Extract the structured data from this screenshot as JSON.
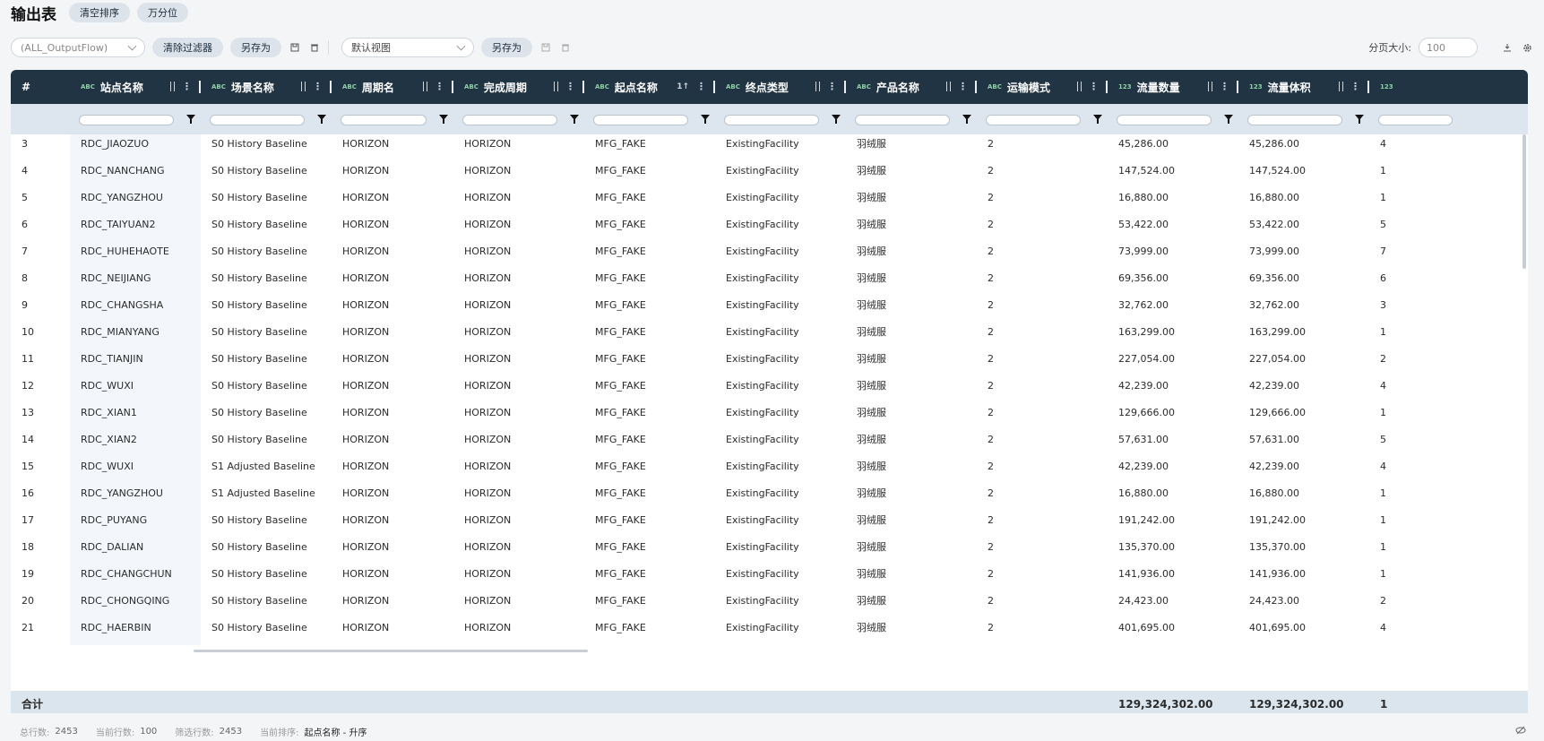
{
  "title": "输出表",
  "top_buttons": [
    "清空排序",
    "万分位"
  ],
  "toolbar": {
    "filter_select": "(ALL_OutputFlow)",
    "clear_filter": "清除过滤器",
    "save_as_1": "另存为",
    "view_select": "默认视图",
    "save_as_2": "另存为",
    "page_size_label": "分页大小:",
    "page_size_value": "100"
  },
  "columns": [
    {
      "label": "#",
      "type": ""
    },
    {
      "label": "站点名称",
      "type": "ABC"
    },
    {
      "label": "场景名称",
      "type": "ABC"
    },
    {
      "label": "周期名",
      "type": "ABC"
    },
    {
      "label": "完成周期",
      "type": "ABC"
    },
    {
      "label": "起点名称",
      "type": "ABC",
      "sort": "1↑"
    },
    {
      "label": "终点类型",
      "type": "ABC"
    },
    {
      "label": "产品名称",
      "type": "ABC"
    },
    {
      "label": "运输模式",
      "type": "ABC"
    },
    {
      "label": "流量数量",
      "type": "123"
    },
    {
      "label": "流量体积",
      "type": "123"
    },
    {
      "label": "",
      "type": "123"
    }
  ],
  "rows": [
    [
      "3",
      "RDC_JIAOZUO",
      "S0 History Baseline",
      "HORIZON",
      "HORIZON",
      "MFG_FAKE",
      "ExistingFacility",
      "羽绒服",
      "2",
      "45,286.00",
      "45,286.00",
      "4"
    ],
    [
      "4",
      "RDC_NANCHANG",
      "S0 History Baseline",
      "HORIZON",
      "HORIZON",
      "MFG_FAKE",
      "ExistingFacility",
      "羽绒服",
      "2",
      "147,524.00",
      "147,524.00",
      "1"
    ],
    [
      "5",
      "RDC_YANGZHOU",
      "S0 History Baseline",
      "HORIZON",
      "HORIZON",
      "MFG_FAKE",
      "ExistingFacility",
      "羽绒服",
      "2",
      "16,880.00",
      "16,880.00",
      "1"
    ],
    [
      "6",
      "RDC_TAIYUAN2",
      "S0 History Baseline",
      "HORIZON",
      "HORIZON",
      "MFG_FAKE",
      "ExistingFacility",
      "羽绒服",
      "2",
      "53,422.00",
      "53,422.00",
      "5"
    ],
    [
      "7",
      "RDC_HUHEHAOTE",
      "S0 History Baseline",
      "HORIZON",
      "HORIZON",
      "MFG_FAKE",
      "ExistingFacility",
      "羽绒服",
      "2",
      "73,999.00",
      "73,999.00",
      "7"
    ],
    [
      "8",
      "RDC_NEIJIANG",
      "S0 History Baseline",
      "HORIZON",
      "HORIZON",
      "MFG_FAKE",
      "ExistingFacility",
      "羽绒服",
      "2",
      "69,356.00",
      "69,356.00",
      "6"
    ],
    [
      "9",
      "RDC_CHANGSHA",
      "S0 History Baseline",
      "HORIZON",
      "HORIZON",
      "MFG_FAKE",
      "ExistingFacility",
      "羽绒服",
      "2",
      "32,762.00",
      "32,762.00",
      "3"
    ],
    [
      "10",
      "RDC_MIANYANG",
      "S0 History Baseline",
      "HORIZON",
      "HORIZON",
      "MFG_FAKE",
      "ExistingFacility",
      "羽绒服",
      "2",
      "163,299.00",
      "163,299.00",
      "1"
    ],
    [
      "11",
      "RDC_TIANJIN",
      "S0 History Baseline",
      "HORIZON",
      "HORIZON",
      "MFG_FAKE",
      "ExistingFacility",
      "羽绒服",
      "2",
      "227,054.00",
      "227,054.00",
      "2"
    ],
    [
      "12",
      "RDC_WUXI",
      "S0 History Baseline",
      "HORIZON",
      "HORIZON",
      "MFG_FAKE",
      "ExistingFacility",
      "羽绒服",
      "2",
      "42,239.00",
      "42,239.00",
      "4"
    ],
    [
      "13",
      "RDC_XIAN1",
      "S0 History Baseline",
      "HORIZON",
      "HORIZON",
      "MFG_FAKE",
      "ExistingFacility",
      "羽绒服",
      "2",
      "129,666.00",
      "129,666.00",
      "1"
    ],
    [
      "14",
      "RDC_XIAN2",
      "S0 History Baseline",
      "HORIZON",
      "HORIZON",
      "MFG_FAKE",
      "ExistingFacility",
      "羽绒服",
      "2",
      "57,631.00",
      "57,631.00",
      "5"
    ],
    [
      "15",
      "RDC_WUXI",
      "S1 Adjusted Baseline",
      "HORIZON",
      "HORIZON",
      "MFG_FAKE",
      "ExistingFacility",
      "羽绒服",
      "2",
      "42,239.00",
      "42,239.00",
      "4"
    ],
    [
      "16",
      "RDC_YANGZHOU",
      "S1 Adjusted Baseline",
      "HORIZON",
      "HORIZON",
      "MFG_FAKE",
      "ExistingFacility",
      "羽绒服",
      "2",
      "16,880.00",
      "16,880.00",
      "1"
    ],
    [
      "17",
      "RDC_PUYANG",
      "S0 History Baseline",
      "HORIZON",
      "HORIZON",
      "MFG_FAKE",
      "ExistingFacility",
      "羽绒服",
      "2",
      "191,242.00",
      "191,242.00",
      "1"
    ],
    [
      "18",
      "RDC_DALIAN",
      "S0 History Baseline",
      "HORIZON",
      "HORIZON",
      "MFG_FAKE",
      "ExistingFacility",
      "羽绒服",
      "2",
      "135,370.00",
      "135,370.00",
      "1"
    ],
    [
      "19",
      "RDC_CHANGCHUN",
      "S0 History Baseline",
      "HORIZON",
      "HORIZON",
      "MFG_FAKE",
      "ExistingFacility",
      "羽绒服",
      "2",
      "141,936.00",
      "141,936.00",
      "1"
    ],
    [
      "20",
      "RDC_CHONGQING",
      "S0 History Baseline",
      "HORIZON",
      "HORIZON",
      "MFG_FAKE",
      "ExistingFacility",
      "羽绒服",
      "2",
      "24,423.00",
      "24,423.00",
      "2"
    ],
    [
      "21",
      "RDC_HAERBIN",
      "S0 History Baseline",
      "HORIZON",
      "HORIZON",
      "MFG_FAKE",
      "ExistingFacility",
      "羽绒服",
      "2",
      "401,695.00",
      "401,695.00",
      "4"
    ]
  ],
  "footer": {
    "label": "合计",
    "flow_qty_total": "129,324,302.00",
    "flow_vol_total": "129,324,302.00",
    "last": "1"
  },
  "status": {
    "total_rows_label": "总行数:",
    "total_rows": "2453",
    "current_rows_label": "当前行数:",
    "current_rows": "100",
    "filtered_rows_label": "筛选行数:",
    "filtered_rows": "2453",
    "current_sort_label": "当前排序:",
    "current_sort": "起点名称 - 升序"
  },
  "colors": {
    "header_bg": "#213444",
    "filter_bg": "#dde6ee",
    "footer_bg": "#dbe5ed",
    "type_tag": "#8fd0a8"
  }
}
